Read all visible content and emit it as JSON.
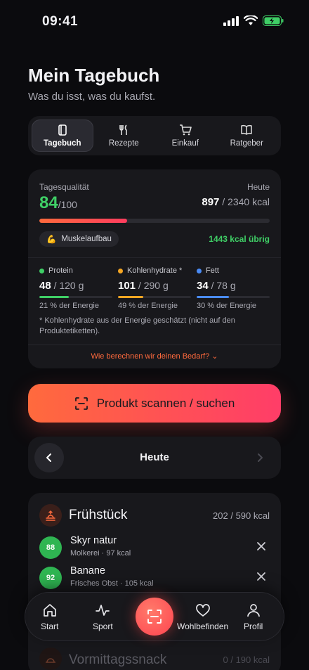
{
  "status_bar": {
    "time": "09:41"
  },
  "header": {
    "title": "Mein Tagebuch",
    "subtitle": "Was du isst, was du kaufst."
  },
  "tabs": [
    {
      "label": "Tagebuch",
      "icon": "diary-icon",
      "active": true
    },
    {
      "label": "Rezepte",
      "icon": "fork-knife-icon",
      "active": false
    },
    {
      "label": "Einkauf",
      "icon": "cart-icon",
      "active": false
    },
    {
      "label": "Ratgeber",
      "icon": "book-icon",
      "active": false
    }
  ],
  "quality": {
    "label": "Tagesqualität",
    "score": "84",
    "score_max": "/100",
    "day_label": "Heute",
    "kcal_consumed": "897",
    "kcal_goal": " / 2340 kcal",
    "progress_fraction": 0.38,
    "goal_emoji": "💪",
    "goal_label": "Muskelaufbau",
    "remaining": "1443 kcal übrig"
  },
  "macros": [
    {
      "name": "Protein",
      "color": "#3fcf66",
      "value": "48",
      "target": " / 120 g",
      "fraction": 0.4,
      "energy": "21 % der Energie"
    },
    {
      "name": "Kohlenhydrate *",
      "color": "#f5a623",
      "value": "101",
      "target": " / 290 g",
      "fraction": 0.35,
      "energy": "49 % der Energie"
    },
    {
      "name": "Fett",
      "color": "#4a8bf5",
      "value": "34",
      "target": " / 78 g",
      "fraction": 0.44,
      "energy": "30 % der Energie"
    }
  ],
  "footnote": "* Kohlenhydrate aus der Energie geschätzt (nicht auf den Produktetiketten).",
  "calc_link": "Wie berechnen wir deinen Bedarf? ⌄",
  "scan_button": "Produkt scannen / suchen",
  "day_nav": {
    "label": "Heute"
  },
  "meal": {
    "title": "Frühstück",
    "kcal": "202 / 590 kcal",
    "items": [
      {
        "score": "88",
        "name": "Skyr natur",
        "sub": "Molkerei · 97 kcal"
      },
      {
        "score": "92",
        "name": "Banane",
        "sub": "Frisches Obst · 105 kcal"
      }
    ]
  },
  "next_meal": {
    "title": "Vormittagssnack",
    "kcal": "0 / 190 kcal"
  },
  "bottom_nav": [
    {
      "label": "Start",
      "icon": "home-icon"
    },
    {
      "label": "Sport",
      "icon": "activity-icon"
    },
    {
      "label": "Wohlbefinden",
      "icon": "heart-icon"
    },
    {
      "label": "Profil",
      "icon": "profile-icon"
    }
  ],
  "colors": {
    "accent": "#ff5a4a",
    "good": "#3fcf66"
  }
}
